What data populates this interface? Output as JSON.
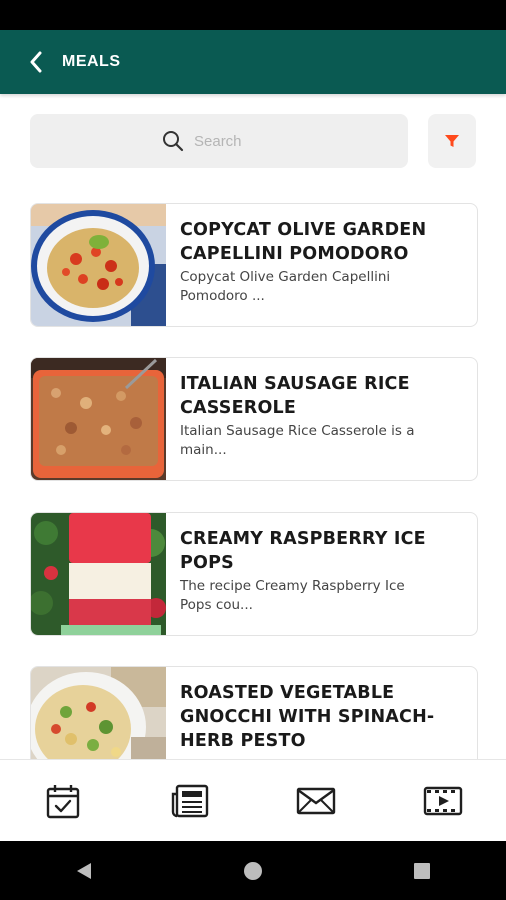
{
  "app_bar": {
    "title": "MEALS"
  },
  "search": {
    "placeholder": "Search"
  },
  "colors": {
    "primary": "#0a5a52",
    "filter_accent": "#ff4a1c",
    "text_dark": "#1a1a1a"
  },
  "meals": [
    {
      "title": "COPYCAT OLIVE GARDEN CAPELLINI POMODORO",
      "description": "Copycat Olive Garden Capellini Pomodoro ..."
    },
    {
      "title": "ITALIAN SAUSAGE RICE CASSEROLE",
      "description": "Italian Sausage Rice Casserole is a main..."
    },
    {
      "title": "CREAMY RASPBERRY ICE POPS",
      "description": "The recipe Creamy Raspberry Ice Pops cou..."
    },
    {
      "title": "ROASTED VEGETABLE GNOCCHI WITH SPINACH-HERB PESTO",
      "description": ""
    }
  ],
  "bottom_nav": [
    {
      "icon": "calendar-check-icon"
    },
    {
      "icon": "newspaper-icon"
    },
    {
      "icon": "envelope-icon"
    },
    {
      "icon": "video-film-icon"
    }
  ],
  "system_nav": [
    {
      "icon": "back-triangle-icon"
    },
    {
      "icon": "home-circle-icon"
    },
    {
      "icon": "recents-square-icon"
    }
  ]
}
